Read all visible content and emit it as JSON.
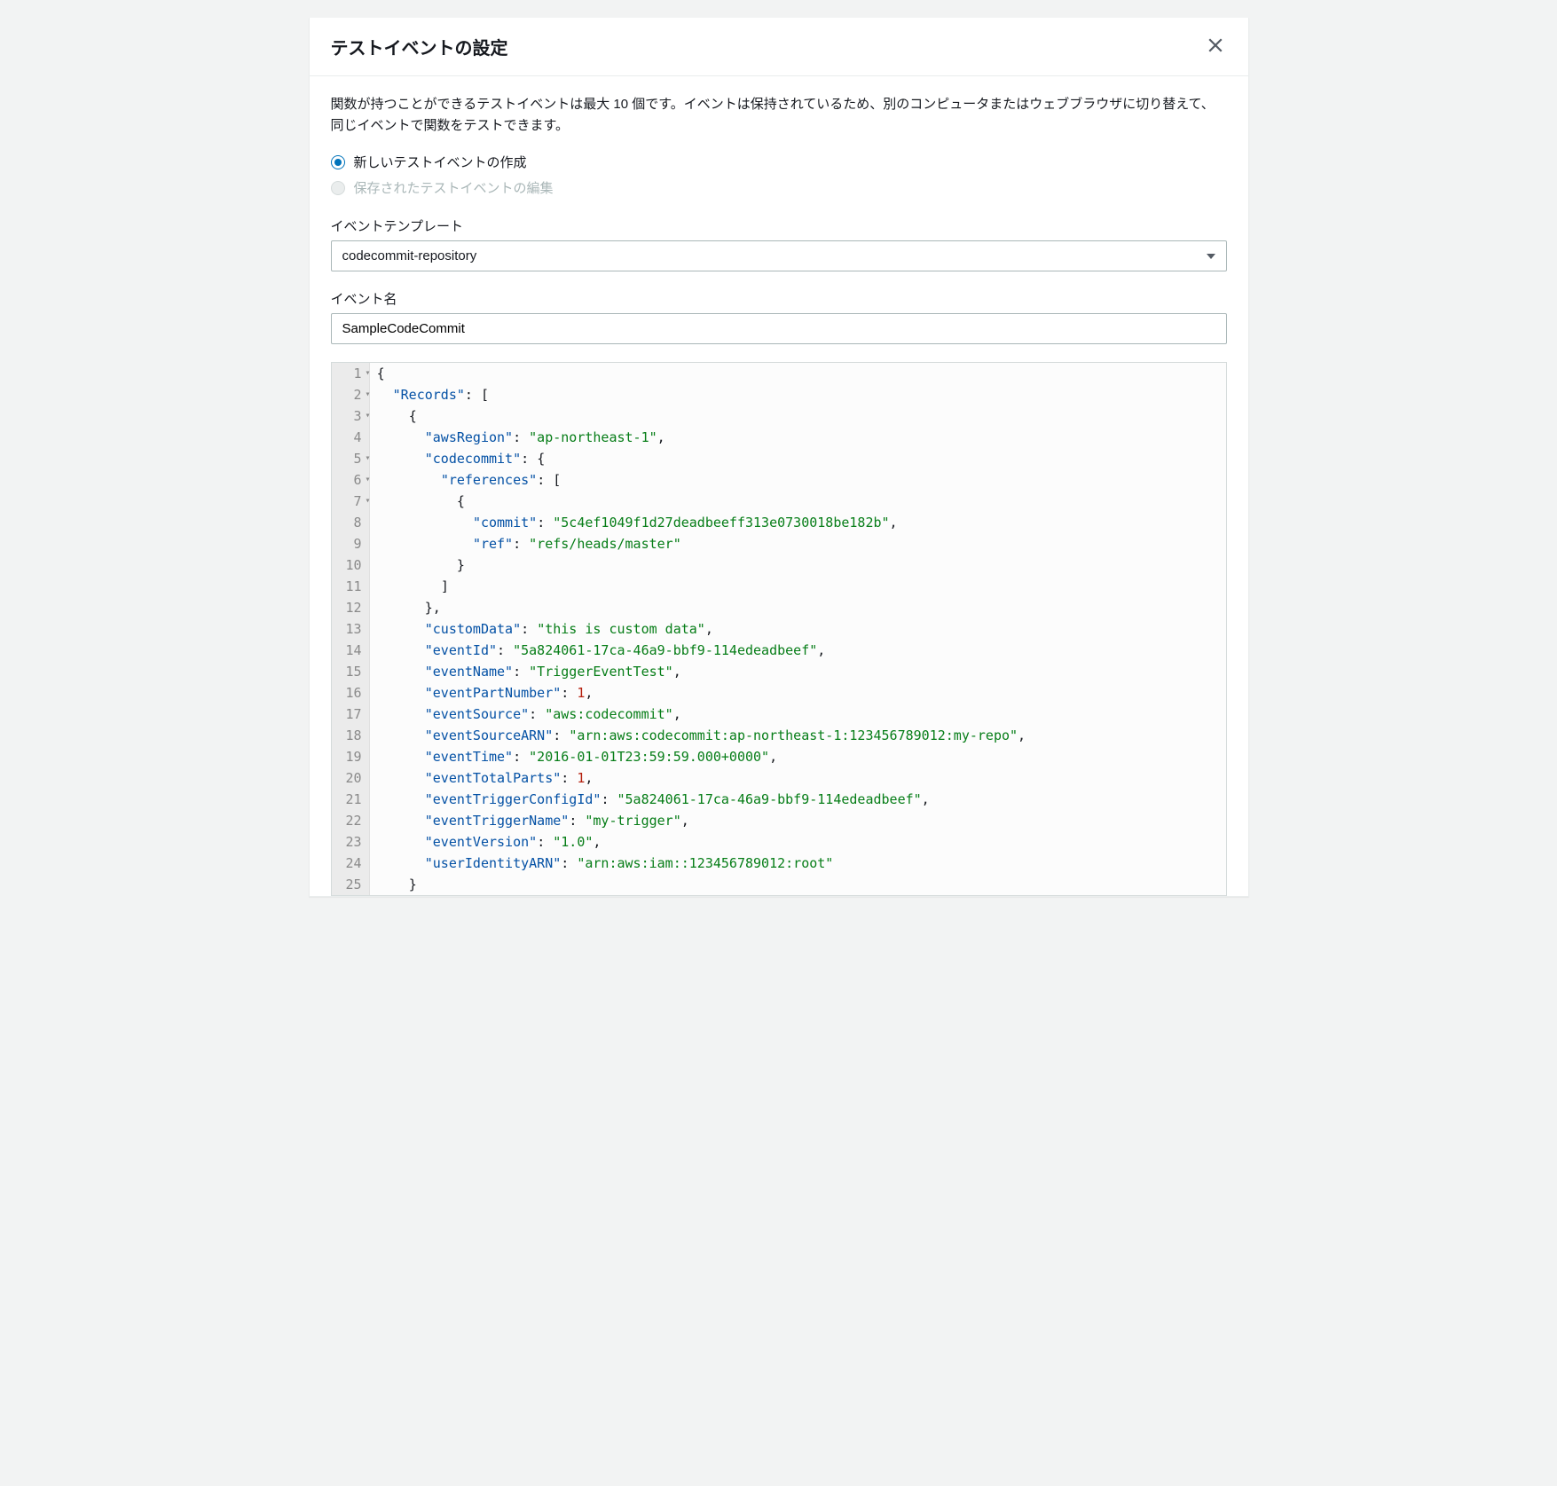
{
  "modal": {
    "title": "テストイベントの設定",
    "description": "関数が持つことができるテストイベントは最大 10 個です。イベントは保持されているため、別のコンピュータまたはウェブブラウザに切り替えて、同じイベントで関数をテストできます。"
  },
  "radio": {
    "create_new": "新しいテストイベントの作成",
    "edit_saved": "保存されたテストイベントの編集"
  },
  "template": {
    "label": "イベントテンプレート",
    "value": "codecommit-repository"
  },
  "event_name": {
    "label": "イベント名",
    "value": "SampleCodeCommit"
  },
  "code": {
    "gutter_rows": [
      "1",
      "2",
      "3",
      "4",
      "5",
      "6",
      "7",
      "8",
      "9",
      "10",
      "11",
      "12",
      "13",
      "14",
      "15",
      "16",
      "17",
      "18",
      "19",
      "20",
      "21",
      "22",
      "23",
      "24",
      "25"
    ],
    "fold_rows": [
      "1",
      "2",
      "3",
      "5",
      "6",
      "7"
    ],
    "json": {
      "Records": [
        {
          "awsRegion": "ap-northeast-1",
          "codecommit": {
            "references": [
              {
                "commit": "5c4ef1049f1d27deadbeeff313e0730018be182b",
                "ref": "refs/heads/master"
              }
            ]
          },
          "customData": "this is custom data",
          "eventId": "5a824061-17ca-46a9-bbf9-114edeadbeef",
          "eventName": "TriggerEventTest",
          "eventPartNumber": 1,
          "eventSource": "aws:codecommit",
          "eventSourceARN": "arn:aws:codecommit:ap-northeast-1:123456789012:my-repo",
          "eventTime": "2016-01-01T23:59:59.000+0000",
          "eventTotalParts": 1,
          "eventTriggerConfigId": "5a824061-17ca-46a9-bbf9-114edeadbeef",
          "eventTriggerName": "my-trigger",
          "eventVersion": "1.0",
          "userIdentityARN": "arn:aws:iam::123456789012:root"
        }
      ]
    },
    "lines": [
      [
        {
          "t": "brace",
          "v": "{"
        }
      ],
      [
        {
          "t": "sp",
          "v": "  "
        },
        {
          "t": "key",
          "v": "\"Records\""
        },
        {
          "t": "punct",
          "v": ": ["
        }
      ],
      [
        {
          "t": "sp",
          "v": "    "
        },
        {
          "t": "brace",
          "v": "{"
        }
      ],
      [
        {
          "t": "sp",
          "v": "      "
        },
        {
          "t": "key",
          "v": "\"awsRegion\""
        },
        {
          "t": "punct",
          "v": ": "
        },
        {
          "t": "string",
          "v": "\"ap-northeast-1\""
        },
        {
          "t": "punct",
          "v": ","
        }
      ],
      [
        {
          "t": "sp",
          "v": "      "
        },
        {
          "t": "key",
          "v": "\"codecommit\""
        },
        {
          "t": "punct",
          "v": ": "
        },
        {
          "t": "brace",
          "v": "{"
        }
      ],
      [
        {
          "t": "sp",
          "v": "        "
        },
        {
          "t": "key",
          "v": "\"references\""
        },
        {
          "t": "punct",
          "v": ": ["
        }
      ],
      [
        {
          "t": "sp",
          "v": "          "
        },
        {
          "t": "brace",
          "v": "{"
        }
      ],
      [
        {
          "t": "sp",
          "v": "            "
        },
        {
          "t": "key",
          "v": "\"commit\""
        },
        {
          "t": "punct",
          "v": ": "
        },
        {
          "t": "string",
          "v": "\"5c4ef1049f1d27deadbeeff313e0730018be182b\""
        },
        {
          "t": "punct",
          "v": ","
        }
      ],
      [
        {
          "t": "sp",
          "v": "            "
        },
        {
          "t": "key",
          "v": "\"ref\""
        },
        {
          "t": "punct",
          "v": ": "
        },
        {
          "t": "string",
          "v": "\"refs/heads/master\""
        }
      ],
      [
        {
          "t": "sp",
          "v": "          "
        },
        {
          "t": "brace",
          "v": "}"
        }
      ],
      [
        {
          "t": "sp",
          "v": "        "
        },
        {
          "t": "punct",
          "v": "]"
        }
      ],
      [
        {
          "t": "sp",
          "v": "      "
        },
        {
          "t": "brace",
          "v": "}"
        },
        {
          "t": "punct",
          "v": ","
        }
      ],
      [
        {
          "t": "sp",
          "v": "      "
        },
        {
          "t": "key",
          "v": "\"customData\""
        },
        {
          "t": "punct",
          "v": ": "
        },
        {
          "t": "string",
          "v": "\"this is custom data\""
        },
        {
          "t": "punct",
          "v": ","
        }
      ],
      [
        {
          "t": "sp",
          "v": "      "
        },
        {
          "t": "key",
          "v": "\"eventId\""
        },
        {
          "t": "punct",
          "v": ": "
        },
        {
          "t": "string",
          "v": "\"5a824061-17ca-46a9-bbf9-114edeadbeef\""
        },
        {
          "t": "punct",
          "v": ","
        }
      ],
      [
        {
          "t": "sp",
          "v": "      "
        },
        {
          "t": "key",
          "v": "\"eventName\""
        },
        {
          "t": "punct",
          "v": ": "
        },
        {
          "t": "string",
          "v": "\"TriggerEventTest\""
        },
        {
          "t": "punct",
          "v": ","
        }
      ],
      [
        {
          "t": "sp",
          "v": "      "
        },
        {
          "t": "key",
          "v": "\"eventPartNumber\""
        },
        {
          "t": "punct",
          "v": ": "
        },
        {
          "t": "number",
          "v": "1"
        },
        {
          "t": "punct",
          "v": ","
        }
      ],
      [
        {
          "t": "sp",
          "v": "      "
        },
        {
          "t": "key",
          "v": "\"eventSource\""
        },
        {
          "t": "punct",
          "v": ": "
        },
        {
          "t": "string",
          "v": "\"aws:codecommit\""
        },
        {
          "t": "punct",
          "v": ","
        }
      ],
      [
        {
          "t": "sp",
          "v": "      "
        },
        {
          "t": "key",
          "v": "\"eventSourceARN\""
        },
        {
          "t": "punct",
          "v": ": "
        },
        {
          "t": "string",
          "v": "\"arn:aws:codecommit:ap-northeast-1:123456789012:my-repo\""
        },
        {
          "t": "punct",
          "v": ","
        }
      ],
      [
        {
          "t": "sp",
          "v": "      "
        },
        {
          "t": "key",
          "v": "\"eventTime\""
        },
        {
          "t": "punct",
          "v": ": "
        },
        {
          "t": "string",
          "v": "\"2016-01-01T23:59:59.000+0000\""
        },
        {
          "t": "punct",
          "v": ","
        }
      ],
      [
        {
          "t": "sp",
          "v": "      "
        },
        {
          "t": "key",
          "v": "\"eventTotalParts\""
        },
        {
          "t": "punct",
          "v": ": "
        },
        {
          "t": "number",
          "v": "1"
        },
        {
          "t": "punct",
          "v": ","
        }
      ],
      [
        {
          "t": "sp",
          "v": "      "
        },
        {
          "t": "key",
          "v": "\"eventTriggerConfigId\""
        },
        {
          "t": "punct",
          "v": ": "
        },
        {
          "t": "string",
          "v": "\"5a824061-17ca-46a9-bbf9-114edeadbeef\""
        },
        {
          "t": "punct",
          "v": ","
        }
      ],
      [
        {
          "t": "sp",
          "v": "      "
        },
        {
          "t": "key",
          "v": "\"eventTriggerName\""
        },
        {
          "t": "punct",
          "v": ": "
        },
        {
          "t": "string",
          "v": "\"my-trigger\""
        },
        {
          "t": "punct",
          "v": ","
        }
      ],
      [
        {
          "t": "sp",
          "v": "      "
        },
        {
          "t": "key",
          "v": "\"eventVersion\""
        },
        {
          "t": "punct",
          "v": ": "
        },
        {
          "t": "string",
          "v": "\"1.0\""
        },
        {
          "t": "punct",
          "v": ","
        }
      ],
      [
        {
          "t": "sp",
          "v": "      "
        },
        {
          "t": "key",
          "v": "\"userIdentityARN\""
        },
        {
          "t": "punct",
          "v": ": "
        },
        {
          "t": "string",
          "v": "\"arn:aws:iam::123456789012:root\""
        }
      ],
      [
        {
          "t": "sp",
          "v": "    "
        },
        {
          "t": "brace",
          "v": "}"
        }
      ]
    ]
  }
}
